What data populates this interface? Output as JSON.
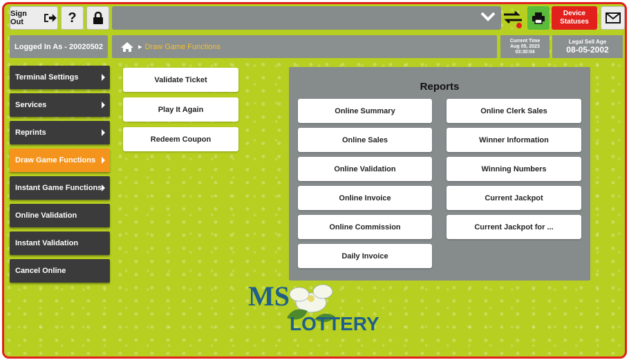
{
  "top": {
    "sign_out_label": "Sign Out",
    "help_label": "?",
    "device_statuses_label": "Device Statuses"
  },
  "session": {
    "logged_in": "Logged In As - 20020502",
    "current_time_label": "Current Time",
    "current_time_date": "Aug 05, 2023",
    "current_time_clock": "03:30:04",
    "legal_age_label": "Legal Sell Age",
    "legal_age_value": "08-05-2002"
  },
  "breadcrumb": {
    "current": "Draw Game Functions"
  },
  "sidebar": {
    "items": [
      {
        "label": "Terminal Settings",
        "arrow": true
      },
      {
        "label": "Services",
        "arrow": true
      },
      {
        "label": "Reprints",
        "arrow": true
      },
      {
        "label": "Draw Game Functions",
        "arrow": true,
        "active": true
      },
      {
        "label": "Instant Game Functions",
        "arrow": true
      },
      {
        "label": "Online Validation",
        "arrow": false
      },
      {
        "label": "Instant Validation",
        "arrow": false
      },
      {
        "label": "Cancel Online",
        "arrow": false
      }
    ]
  },
  "draw_functions": [
    "Validate Ticket",
    "Play It Again",
    "Redeem Coupon"
  ],
  "reports": {
    "title": "Reports",
    "left": [
      "Online Summary",
      "Online Sales",
      "Online Validation",
      "Online Invoice",
      "Online Commission",
      "Daily Invoice"
    ],
    "right": [
      "Online Clerk Sales",
      "Winner Information",
      "Winning Numbers",
      "Current Jackpot",
      "Current Jackpot for ..."
    ]
  },
  "logo": {
    "ms": "MS",
    "lottery": "LOTTERY"
  },
  "colors": {
    "background": "#b6cf20",
    "active": "#f5941d",
    "alert": "#e3211c",
    "panel": "#868b8c",
    "breadcrumb_text": "#f4c12b"
  }
}
